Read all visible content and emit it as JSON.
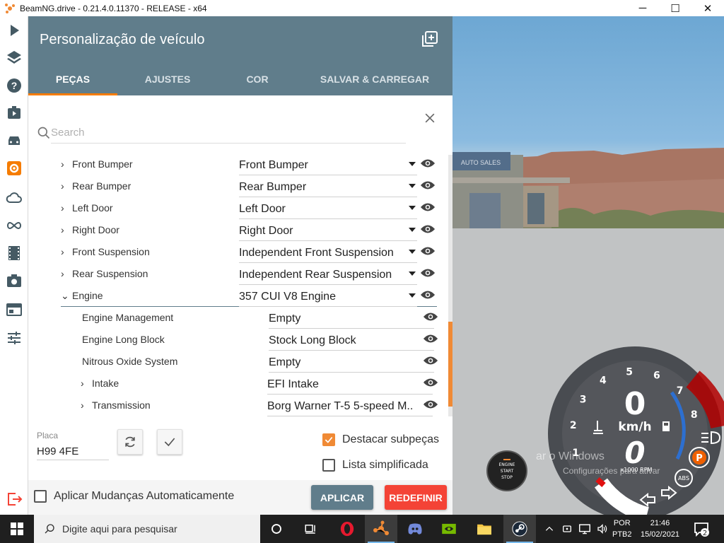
{
  "window": {
    "title": "BeamNG.drive - 0.21.4.0.11370 - RELEASE - x64",
    "minimize": "─",
    "maximize": "☐",
    "close": "✕"
  },
  "sidebar": {
    "icons": [
      "play-icon",
      "layers-icon",
      "help-icon",
      "scenario-icon",
      "car-icon",
      "vehicle-config-icon",
      "cloud-icon",
      "infinity-icon",
      "film-icon",
      "camera-icon",
      "ui-apps-icon",
      "settings-sliders-icon",
      "exit-icon"
    ]
  },
  "panel": {
    "title": "Personalização de veículo",
    "tabs": [
      {
        "label": "PEÇAS",
        "active": true
      },
      {
        "label": "AJUSTES",
        "active": false
      },
      {
        "label": "COR",
        "active": false
      },
      {
        "label": "SALVAR & CARREGAR",
        "active": false
      }
    ],
    "search": {
      "placeholder": "Search",
      "value": ""
    },
    "parts": [
      {
        "name": "Front Bumper",
        "value": "Front Bumper",
        "level": 0,
        "chevron": "›"
      },
      {
        "name": "Rear Bumper",
        "value": "Rear Bumper",
        "level": 0,
        "chevron": "›"
      },
      {
        "name": "Left Door",
        "value": "Left Door",
        "level": 0,
        "chevron": "›"
      },
      {
        "name": "Right Door",
        "value": "Right Door",
        "level": 0,
        "chevron": "›"
      },
      {
        "name": "Front Suspension",
        "value": "Independent Front Suspension",
        "level": 0,
        "chevron": "›"
      },
      {
        "name": "Rear Suspension",
        "value": "Independent Rear Suspension",
        "level": 0,
        "chevron": "›"
      },
      {
        "name": "Engine",
        "value": "357 CUI V8 Engine",
        "level": 0,
        "chevron": "⌄",
        "expanded": true
      },
      {
        "name": "Engine Management",
        "value": "Empty",
        "level": 1,
        "chevron": ""
      },
      {
        "name": "Engine Long Block",
        "value": "Stock Long Block",
        "level": 1,
        "chevron": ""
      },
      {
        "name": "Nitrous Oxide System",
        "value": "Empty",
        "level": 1,
        "chevron": ""
      },
      {
        "name": "Intake",
        "value": "EFI Intake",
        "level": 1,
        "chevron": "›"
      },
      {
        "name": "Transmission",
        "value": "Borg Warner T-5 5-speed M...",
        "level": 1,
        "chevron": "›"
      }
    ],
    "placa_label": "Placa",
    "placa_value": "H99 4FE",
    "highlight_subparts": {
      "label": "Destacar subpeças",
      "checked": true
    },
    "simple_list": {
      "label": "Lista simplificada",
      "checked": false
    },
    "auto_apply": {
      "label": "Aplicar Mudanças Automaticamente",
      "checked": false
    },
    "apply_label": "APLICAR",
    "reset_label": "REDEFINIR"
  },
  "hud": {
    "speed": "0",
    "speed_unit": "km/h",
    "gear": "0",
    "rpm_label": "x1000 RPM",
    "tach_numbers": [
      "1",
      "2",
      "3",
      "4",
      "5",
      "6",
      "7",
      "8"
    ],
    "engine_button": [
      "ENGINE",
      "START",
      "STOP"
    ],
    "abs": "ABS",
    "parking": "P",
    "watermark_line1": "ar o Windows",
    "watermark_line2": "Configurações para ativar"
  },
  "building_sign": "AUTO SALES",
  "taskbar": {
    "search_placeholder": "Digite aqui para pesquisar",
    "lang_line1": "POR",
    "lang_line2": "PTB2",
    "time": "21:46",
    "date": "15/02/2021",
    "notifications": "2"
  },
  "colors": {
    "header": "#607d8b",
    "accent": "#f08a35",
    "reset": "#f44336"
  }
}
